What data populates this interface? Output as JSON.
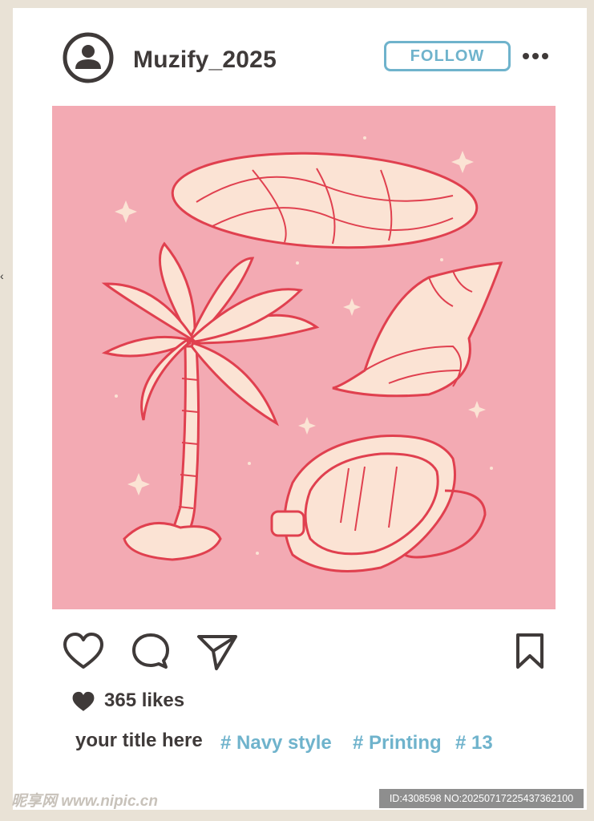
{
  "post": {
    "username": "Muzify_2025",
    "follow_label": "FOLLOW",
    "likes": "365 likes",
    "caption": "your title here",
    "hashtags": [
      "# Navy style",
      "# Printing",
      "# 13"
    ]
  },
  "icons": {
    "avatar": "user-avatar-icon",
    "more": "more-options-icon",
    "like": "heart-icon",
    "comment": "comment-icon",
    "share": "send-icon",
    "save": "bookmark-icon",
    "likes_heart": "filled-heart-icon"
  },
  "colors": {
    "accent": "#6fb3cc",
    "text": "#3f3a39",
    "image_bg": "#f3aab3",
    "line_art": "#e0404f",
    "fill": "#fbe3d4"
  },
  "footer": {
    "watermark": "昵享网 www.nipic.cn",
    "image_id": "ID:4308598 NO:20250717225437362100"
  },
  "edge_mark": "‹"
}
